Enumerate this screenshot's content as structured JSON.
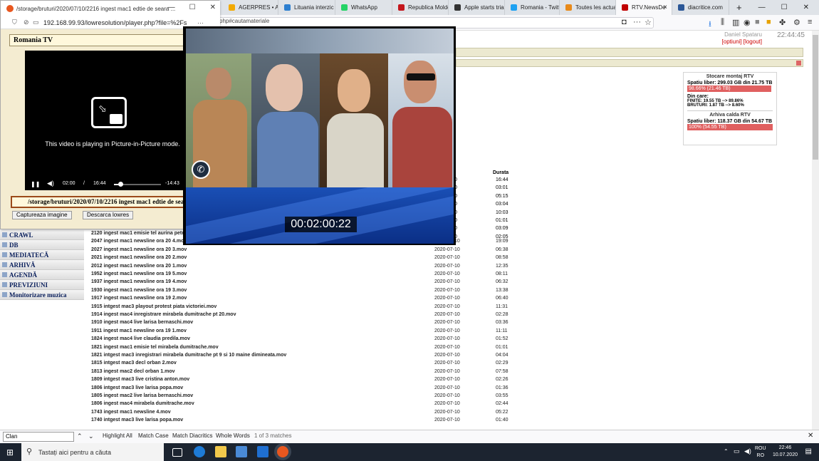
{
  "browser": {
    "tabs": [
      {
        "label": "AGERPRES • Actu",
        "color": "#f2a900"
      },
      {
        "label": "Lituania interzic",
        "color": "#2d7fd0"
      },
      {
        "label": "WhatsApp",
        "color": "#25d366"
      },
      {
        "label": "Republica Moldo",
        "color": "#c4161c"
      },
      {
        "label": "Apple starts tria",
        "color": "#333333"
      },
      {
        "label": "Romania - Twitt",
        "color": "#1da1f2"
      },
      {
        "label": "Toutes les actua",
        "color": "#e88a1a"
      },
      {
        "label": "RTV.NewsDe",
        "color": "#c00000"
      },
      {
        "label": "diacritice.com",
        "color": "#2b5797"
      }
    ],
    "url_visible": "php#cautamateriale",
    "tab_close": "×",
    "new_tab": "+"
  },
  "window_controls": {
    "minimize": "—",
    "maximize": "☐",
    "close": "✕"
  },
  "header": {
    "user_name": "Daniel Spataru",
    "clock": "22:44:45",
    "links": "[optiuni] [logout]"
  },
  "storage": {
    "title1": "Stocare montaj RTV",
    "free1": "Spatiu liber: 299.03 GB din 21.75 TB",
    "bar1": "98.66% (21.46 TB)",
    "bar1_pct": 98.66,
    "din_care": "Din care:",
    "finite": "FINITE: 19.55 TB --> 89.86%",
    "bruturi": "BRUTURI: 1.87 TB --> 8.60%",
    "title2": "Arhiva calda RTV",
    "free2": "Spatiu liber: 118.37 GB din 54.67 TB",
    "bar2": "100% (54.55 TB)",
    "bar2_pct": 100,
    "bar_color": "#e06060"
  },
  "sidebar": [
    {
      "label": "CRAWL"
    },
    {
      "label": "DB"
    },
    {
      "label": "MEDIATECĂ"
    },
    {
      "label": "ARHIVĂ"
    },
    {
      "label": "AGENDĂ"
    },
    {
      "label": "PREVIZIUNI"
    },
    {
      "label": "Monitorizare muzica"
    }
  ],
  "table": {
    "duration_header": "Durata",
    "top_durations": [
      "16:44",
      "03:01",
      "05:15",
      "03:04",
      "10:03",
      "01:01",
      "03:09",
      "02:05"
    ],
    "partial_date": "0",
    "rows": [
      {
        "name": "2120 ingest mac1 emisie tel aurina petr",
        "date": "",
        "dur": ""
      },
      {
        "name": "2047 ingest mac1 newsline ora 20 4.mov",
        "date": "2020-07-10",
        "dur": "19:09"
      },
      {
        "name": "2027 ingest mac1 newsline ora 20 3.mov",
        "date": "2020-07-10",
        "dur": "06:38"
      },
      {
        "name": "2021 ingest mac1 newsline ora 20 2.mov",
        "date": "2020-07-10",
        "dur": "08:58"
      },
      {
        "name": "2012 ingest mac1 newsline ora 20 1.mov",
        "date": "2020-07-10",
        "dur": "12:35"
      },
      {
        "name": "1952 ingest mac1 newsline ora 19 5.mov",
        "date": "2020-07-10",
        "dur": "08:11"
      },
      {
        "name": "1937 ingest mac1 newsline ora 19 4.mov",
        "date": "2020-07-10",
        "dur": "06:32"
      },
      {
        "name": "1930 ingest mac1 newsline ora 19 3.mov",
        "date": "2020-07-10",
        "dur": "13:38"
      },
      {
        "name": "1917 ingest mac1 newsline ora 19 2.mov",
        "date": "2020-07-10",
        "dur": "06:40"
      },
      {
        "name": "1915 intgest mac3 playout protest piata victoriei.mov",
        "date": "2020-07-10",
        "dur": "11:31"
      },
      {
        "name": "1914 ingest mac4 inregistrare mirabela dumitrache pt 20.mov",
        "date": "2020-07-10",
        "dur": "02:28"
      },
      {
        "name": "1910 ingest mac4 live larisa bernaschi.mov",
        "date": "2020-07-10",
        "dur": "03:36"
      },
      {
        "name": "1911 ingest mac1 newsline ora 19 1.mov",
        "date": "2020-07-10",
        "dur": "11:11"
      },
      {
        "name": "1824 ingest mac4 live claudia predila.mov",
        "date": "2020-07-10",
        "dur": "01:52"
      },
      {
        "name": "1821 ingest mac1 emisie tel mirabela dumitrache.mov",
        "date": "2020-07-10",
        "dur": "01:01"
      },
      {
        "name": "1821 intgest mac3 inregistrari mirabela dumitrache pt 9 si 10 maine dimineata.mov",
        "date": "2020-07-10",
        "dur": "04:04"
      },
      {
        "name": "1815 intgest mac3 decl orban 2.mov",
        "date": "2020-07-10",
        "dur": "02:29"
      },
      {
        "name": "1813 ingest mac2 decl orban 1.mov",
        "date": "2020-07-10",
        "dur": "07:58"
      },
      {
        "name": "1809 intgest mac3 live cristina anton.mov",
        "date": "2020-07-10",
        "dur": "02:26"
      },
      {
        "name": "1806 intgest mac3 live larisa popa.mov",
        "date": "2020-07-10",
        "dur": "01:36"
      },
      {
        "name": "1805 ingest mac2 live larisa bernaschi.mov",
        "date": "2020-07-10",
        "dur": "03:55"
      },
      {
        "name": "1806 ingest mac4 mirabela dumitrache.mov",
        "date": "2020-07-10",
        "dur": "02:44"
      },
      {
        "name": "1743 ingest mac1 newsline 4.mov",
        "date": "2020-07-10",
        "dur": "05:22"
      },
      {
        "name": "1740 intgest mac3 live larisa popa.mov",
        "date": "2020-07-10",
        "dur": "01:40"
      }
    ]
  },
  "popup": {
    "title": "/storage/bruturi/2020/07/10/2216 ingest mac1 edtie de seara ...",
    "url": "192.168.99.93/lowresolution/player.php?file=%2Fs",
    "box_title": "Romania TV",
    "pip_message": "This video is playing in Picture-in-Picture mode.",
    "time_current": "02:00",
    "time_sep": "/",
    "time_total": "16:44",
    "time_remaining": "-14:43",
    "progress_pct": 12,
    "path": "/storage/bruturi/2020/07/10/2216 ingest mac1 edtie de seara 1",
    "btn_capture": "Captureaza imagine",
    "btn_download": "Descarca lowres"
  },
  "video": {
    "timecode": "00:02:00:22"
  },
  "findbar": {
    "query": "Clan",
    "highlight": "Highlight All",
    "match_case": "Match Case",
    "diacritics": "Match Diacritics",
    "whole": "Whole Words",
    "result": "1 of 3 matches"
  },
  "taskbar": {
    "search_placeholder": "Tastați aici pentru a căuta",
    "lang1": "ROU",
    "lang2": "RO",
    "time": "22:46",
    "date": "10.07.2020"
  }
}
